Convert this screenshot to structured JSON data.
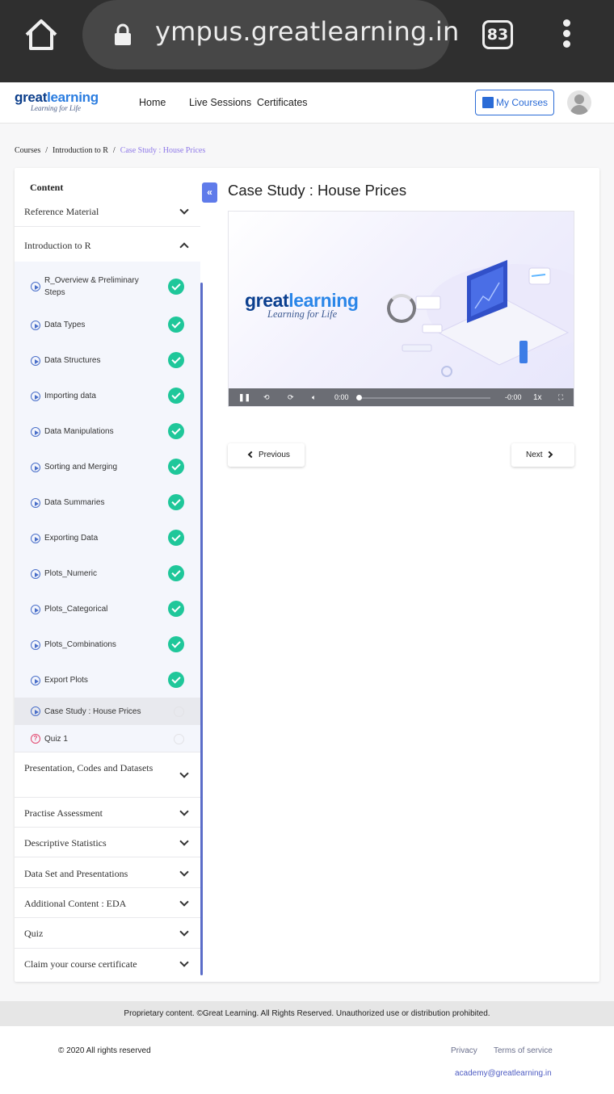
{
  "browser": {
    "url": "ympus.greatlearning.in",
    "tab_count": "83"
  },
  "header": {
    "logo_main": "great",
    "logo_accent": "learning",
    "logo_tagline": "Learning for Life",
    "nav": [
      "Home",
      "Live Sessions",
      "Certificates"
    ],
    "my_courses_label": "My Courses"
  },
  "breadcrumb": {
    "items": [
      "Courses",
      "Introduction to R"
    ],
    "current": "Case Study : House Prices"
  },
  "sidebar": {
    "content_label": "Content",
    "sections_top": [
      {
        "title": "Reference Material",
        "expanded": false
      },
      {
        "title": "Introduction to R",
        "expanded": true
      }
    ],
    "lessons": [
      {
        "title": "R_Overview & Preliminary Steps",
        "completed": true
      },
      {
        "title": "Data Types",
        "completed": true
      },
      {
        "title": "Data Structures",
        "completed": true
      },
      {
        "title": "Importing data",
        "completed": true
      },
      {
        "title": "Data Manipulations",
        "completed": true
      },
      {
        "title": "Sorting and Merging",
        "completed": true
      },
      {
        "title": "Data Summaries",
        "completed": true
      },
      {
        "title": "Exporting Data",
        "completed": true
      },
      {
        "title": "Plots_Numeric",
        "completed": true
      },
      {
        "title": "Plots_Categorical",
        "completed": true
      },
      {
        "title": "Plots_Combinations",
        "completed": true
      },
      {
        "title": "Export Plots",
        "completed": true
      },
      {
        "title": "Case Study : House Prices",
        "completed": false,
        "active": true
      },
      {
        "title": "Quiz 1",
        "completed": false,
        "type": "quiz"
      }
    ],
    "sections_bottom": [
      {
        "title": "Presentation, Codes and Datasets"
      },
      {
        "title": "Practise Assessment"
      },
      {
        "title": "Descriptive Statistics"
      },
      {
        "title": "Data Set and Presentations"
      },
      {
        "title": "Additional Content : EDA"
      },
      {
        "title": "Quiz"
      },
      {
        "title": "Claim your course certificate"
      }
    ]
  },
  "main": {
    "title": "Case Study : House Prices",
    "video": {
      "logo_main": "great",
      "logo_accent": "learning",
      "tagline": "Learning for Life",
      "time_current": "0:00",
      "time_remaining": "-0:00",
      "speed": "1x",
      "progress": 0
    },
    "previous_label": "Previous",
    "next_label": "Next"
  },
  "footer": {
    "notice": "Proprietary content. ©Great Learning. All Rights Reserved. Unauthorized use or distribution prohibited.",
    "rights": "© 2020 All rights reserved",
    "privacy": "Privacy",
    "terms": "Terms of service",
    "email": "academy@greatlearning.in"
  },
  "colors": {
    "accent": "#2a6bd6",
    "complete": "#1fc79a",
    "breadcrumb_current": "#8e78e8",
    "toggle": "#5f7bea"
  },
  "icons": [
    "home-icon",
    "lock-icon",
    "menu-kebab-icon",
    "book-icon",
    "user-avatar-icon",
    "chevron-down-icon",
    "chevron-up-icon",
    "play-circle-icon",
    "check-circle-icon",
    "quiz-icon",
    "collapse-left-icon"
  ]
}
